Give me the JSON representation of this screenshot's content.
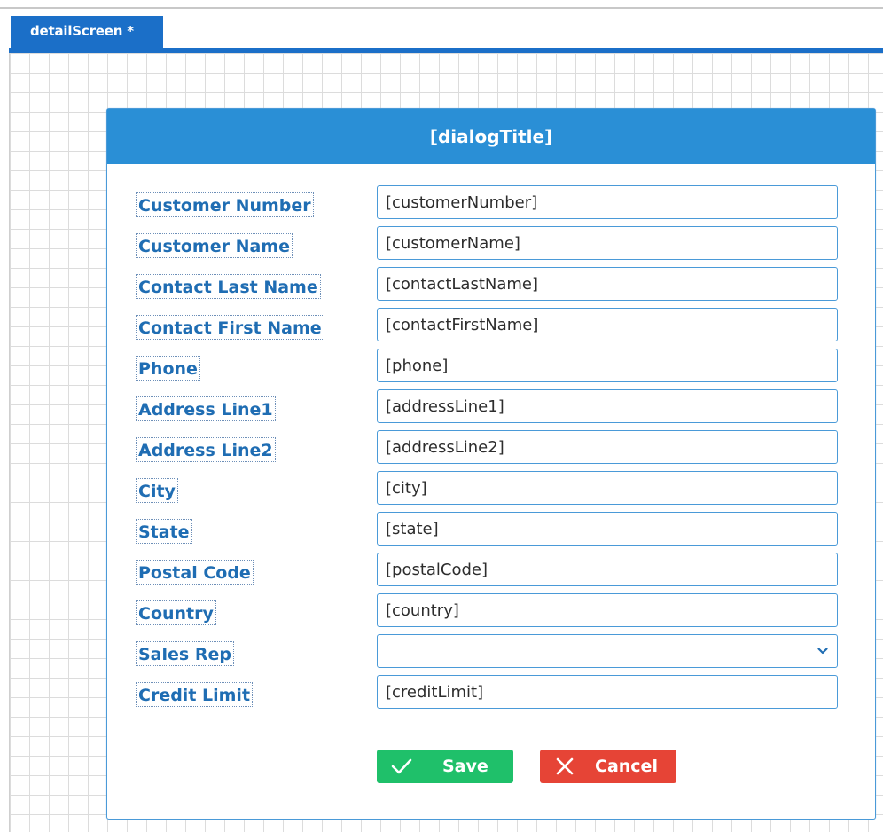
{
  "tab": {
    "label": "detailScreen *"
  },
  "dialog": {
    "title": "[dialogTitle]",
    "fields": [
      {
        "label": "Customer Number",
        "value": "[customerNumber]"
      },
      {
        "label": "Customer Name",
        "value": "[customerName]"
      },
      {
        "label": "Contact Last Name",
        "value": "[contactLastName]"
      },
      {
        "label": "Contact First Name",
        "value": "[contactFirstName]"
      },
      {
        "label": "Phone",
        "value": "[phone]"
      },
      {
        "label": "Address Line1",
        "value": "[addressLine1]"
      },
      {
        "label": "Address Line2",
        "value": "[addressLine2]"
      },
      {
        "label": "City",
        "value": "[city]"
      },
      {
        "label": "State",
        "value": "[state]"
      },
      {
        "label": "Postal Code",
        "value": "[postalCode]"
      },
      {
        "label": "Country",
        "value": "[country]"
      },
      {
        "label": "Sales Rep",
        "value": ""
      },
      {
        "label": "Credit Limit",
        "value": "[creditLimit]"
      }
    ],
    "buttons": {
      "save_label": "Save",
      "cancel_label": "Cancel"
    }
  },
  "colors": {
    "tab": "#1b6fc8",
    "header": "#2a8fd6",
    "label_text": "#1f6db3",
    "save": "#1fc06a",
    "cancel": "#e64436"
  },
  "icons": {
    "save": "check-icon",
    "cancel": "x-icon",
    "dropdown": "chevron-down-icon"
  }
}
